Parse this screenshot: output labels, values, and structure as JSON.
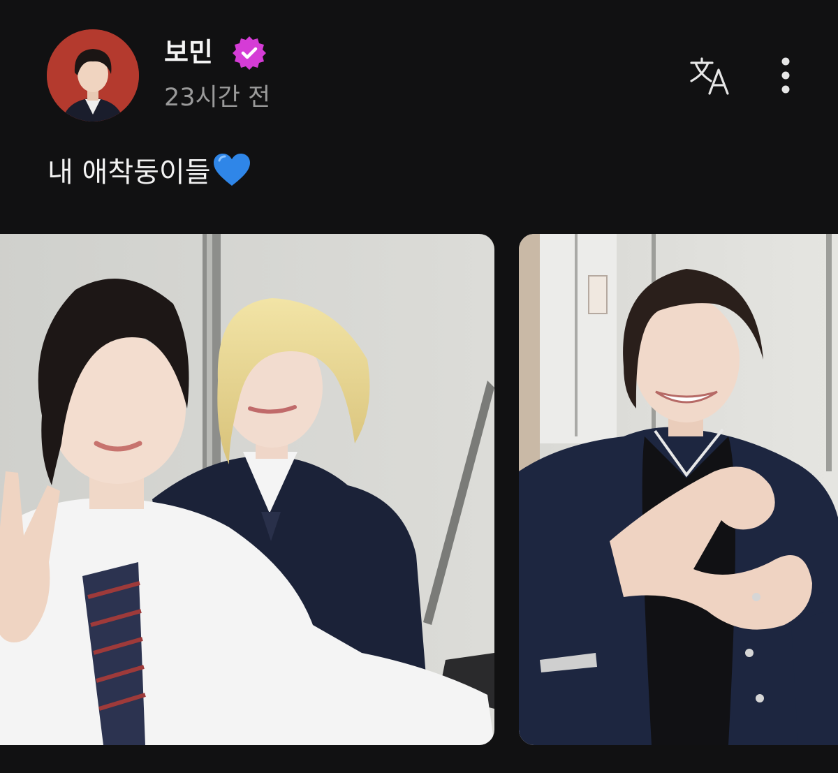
{
  "post": {
    "author": {
      "name": "보민",
      "verified": true,
      "avatar_icon": "profile-avatar"
    },
    "timestamp": "23시간 전",
    "text": "내 애착둥이들",
    "emoji": "blue-heart-icon",
    "actions": {
      "translate_icon": "translate-icon",
      "more_icon": "more-vertical-icon"
    },
    "photos": [
      {
        "icon": "photo-two-friends-selfie"
      },
      {
        "icon": "photo-heart-hands"
      }
    ]
  },
  "colors": {
    "background": "#111112",
    "verified_badge": "#d53cd6",
    "timestamp": "#9a9a9a",
    "heart": "#2f86e8"
  }
}
